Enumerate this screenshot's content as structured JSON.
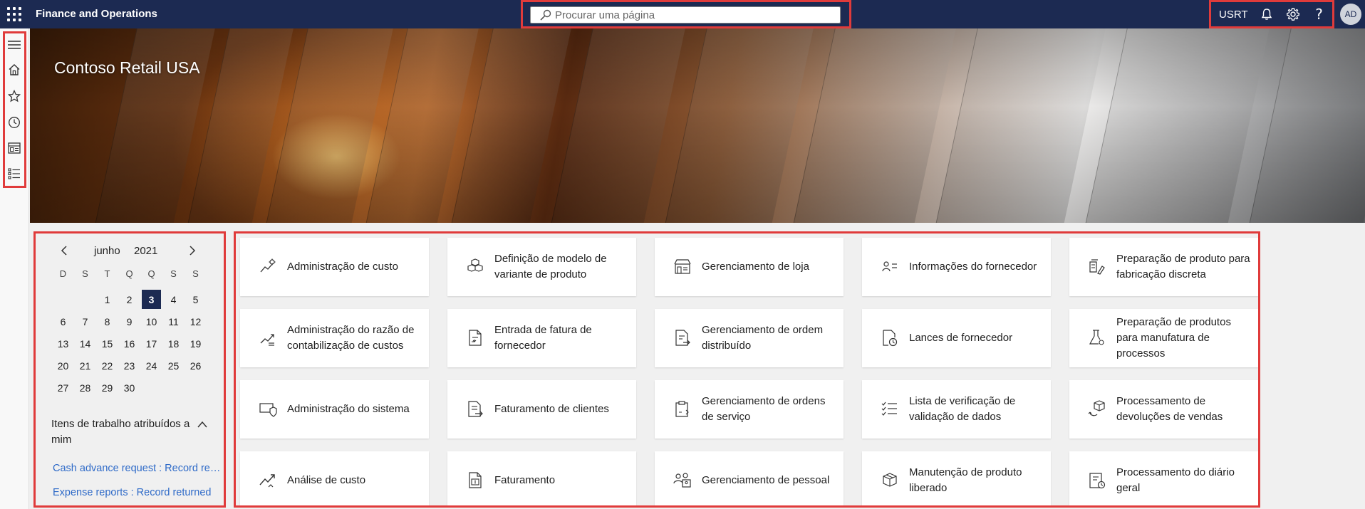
{
  "topbar": {
    "app_title": "Finance and Operations",
    "search_placeholder": "Procurar uma página",
    "company_code": "USRT",
    "avatar_initials": "AD"
  },
  "hero": {
    "title": "Contoso Retail USA"
  },
  "calendar": {
    "month": "junho",
    "year": "2021",
    "weekdays": [
      "D",
      "S",
      "T",
      "Q",
      "Q",
      "S",
      "S"
    ],
    "leading_blanks": 2,
    "days": [
      "1",
      "2",
      "3",
      "4",
      "5",
      "6",
      "7",
      "8",
      "9",
      "10",
      "11",
      "12",
      "13",
      "14",
      "15",
      "16",
      "17",
      "18",
      "19",
      "20",
      "21",
      "22",
      "23",
      "24",
      "25",
      "26",
      "27",
      "28",
      "29",
      "30"
    ],
    "selected_day": "3"
  },
  "work_items": {
    "heading": "Itens de trabalho atribuídos a mim",
    "links": [
      "Cash advance request : Record ret...",
      "Expense reports : Record returned"
    ]
  },
  "tiles": [
    {
      "label": "Administração de custo",
      "icon": "cost-admin-icon"
    },
    {
      "label": "Definição de modelo de variante de produto",
      "icon": "cubes-icon"
    },
    {
      "label": "Gerenciamento de loja",
      "icon": "store-icon"
    },
    {
      "label": "Informações do fornecedor",
      "icon": "contact-card-icon"
    },
    {
      "label": "Preparação de produto para fabricação discreta",
      "icon": "manufacturing-icon"
    },
    {
      "label": "Administração do razão de contabilização de custos",
      "icon": "ledger-chart-icon"
    },
    {
      "label": "Entrada de fatura de fornecedor",
      "icon": "invoice-icon"
    },
    {
      "label": "Gerenciamento de ordem distribuído",
      "icon": "order-document-icon"
    },
    {
      "label": "Lances de fornecedor",
      "icon": "bid-clock-icon"
    },
    {
      "label": "Preparação de produtos para manufatura de processos",
      "icon": "flask-icon"
    },
    {
      "label": "Administração do sistema",
      "icon": "system-shield-icon"
    },
    {
      "label": "Faturamento de clientes",
      "icon": "billing-icon"
    },
    {
      "label": "Gerenciamento de ordens de serviço",
      "icon": "clipboard-icon"
    },
    {
      "label": "Lista de verificação de validação de dados",
      "icon": "checklist-icon"
    },
    {
      "label": "Processamento de devoluções de vendas",
      "icon": "return-box-icon"
    },
    {
      "label": "Análise de custo",
      "icon": "trend-icon"
    },
    {
      "label": "Faturamento",
      "icon": "invoice-dollar-icon"
    },
    {
      "label": "Gerenciamento de pessoal",
      "icon": "people-icon"
    },
    {
      "label": "Manutenção de produto liberado",
      "icon": "product-box-icon"
    },
    {
      "label": "Processamento do diário geral",
      "icon": "journal-icon"
    }
  ],
  "colors": {
    "topbar": "#1c2a52",
    "highlight_border": "#e03b3b",
    "link": "#2e6ac8",
    "selected_day": "#1c2a52"
  }
}
